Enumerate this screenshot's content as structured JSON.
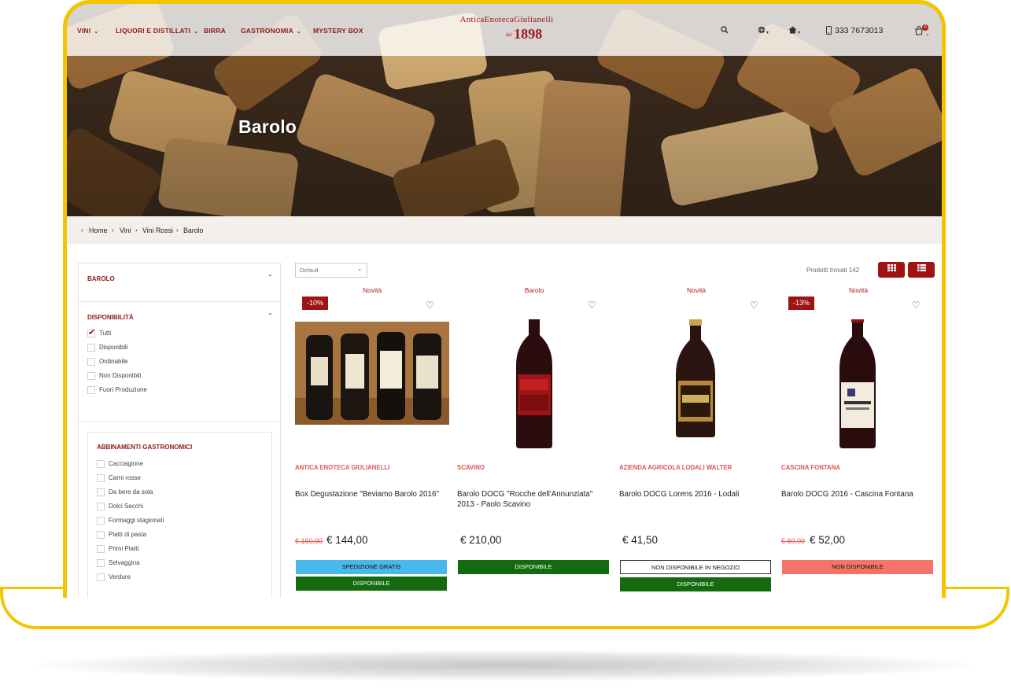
{
  "colors": {
    "accent": "#8b1a1a",
    "brand_red": "#a11919",
    "frame_yellow": "#f2c500",
    "green": "#146b0f",
    "blue": "#48b9ea",
    "salmon": "#f67467"
  },
  "nav": {
    "items": [
      {
        "label": "VINI",
        "has_dropdown": true
      },
      {
        "label": "LIQUORI E DISTILLATI",
        "has_dropdown": true
      },
      {
        "label": "BIRRA",
        "has_dropdown": false
      },
      {
        "label": "GASTRONOMIA",
        "has_dropdown": true
      },
      {
        "label": "MYSTERY BOX",
        "has_dropdown": false
      }
    ],
    "logo": {
      "name": "AnticaEnotecaGiulianelli",
      "since": "dal",
      "year": "1898"
    },
    "icons": [
      "search-icon",
      "globe-icon",
      "home-icon",
      "phone-icon",
      "cart-icon"
    ],
    "phone": "333 7673013",
    "cart_count": "0"
  },
  "hero": {
    "title": "Barolo"
  },
  "breadcrumb": [
    "Home",
    "Vini",
    "Vini Rossi",
    "Barolo"
  ],
  "sidebar": {
    "filter1_title": "BAROLO",
    "availability": {
      "title": "DISPONIBILITÀ",
      "options": [
        {
          "label": "Tutti",
          "checked": true
        },
        {
          "label": "Disponibili",
          "checked": false
        },
        {
          "label": "Ordinabile",
          "checked": false
        },
        {
          "label": "Non Disponibili",
          "checked": false
        },
        {
          "label": "Fuori Produzione",
          "checked": false
        }
      ]
    },
    "pairings": {
      "title": "ABBINAMENTI GASTRONOMICI",
      "options": [
        "Cacciagione",
        "Carni rosse",
        "Da bere da sola",
        "Dolci Secchi",
        "Formaggi stagionati",
        "Piatti di pasta",
        "Primi Piatti",
        "Selvaggina",
        "Verdure"
      ]
    }
  },
  "toolbar": {
    "sort_value": "Default",
    "results": "Prodotti trovati 142",
    "view_icons": [
      "grid-icon",
      "list-icon"
    ]
  },
  "products": [
    {
      "tag": "Novità",
      "discount": "-10%",
      "brand": "ANTICA ENOTECA GIULIANELLI",
      "name": "Box Degustazione \"Beviamo Barolo 2016\"",
      "old_price": "€ 160,00",
      "price": "€ 144,00",
      "buttons": [
        {
          "label": "SPEDIZIONE GRATIS",
          "style": "blue"
        },
        {
          "label": "DISPONIBILE",
          "style": "green"
        }
      ]
    },
    {
      "tag": "Barolo",
      "discount": "",
      "brand": "SCAVINO",
      "name": "Barolo DOCG \"Rocche dell'Annunziata\" 2013 - Paolo Scavino",
      "old_price": "",
      "price": "€ 210,00",
      "buttons": [
        {
          "label": "DISPONIBILE",
          "style": "green"
        }
      ]
    },
    {
      "tag": "Novità",
      "discount": "",
      "brand": "AZIENDA AGRICOLA LODALI WALTER",
      "name": "Barolo DOCG Lorens 2016 - Lodali",
      "old_price": "",
      "price": "€ 41,50",
      "buttons": [
        {
          "label": "NON DISPONIBILE IN NEGOZIO",
          "style": "white"
        },
        {
          "label": "DISPONIBILE",
          "style": "green"
        }
      ]
    },
    {
      "tag": "Novità",
      "discount": "-13%",
      "brand": "CASCINA FONTANA",
      "name": "Barolo DOCG 2016 - Cascina Fontana",
      "old_price": "€ 60,00",
      "price": "€ 52,00",
      "buttons": [
        {
          "label": "NON DISPONIBILE",
          "style": "salmon"
        }
      ]
    }
  ]
}
